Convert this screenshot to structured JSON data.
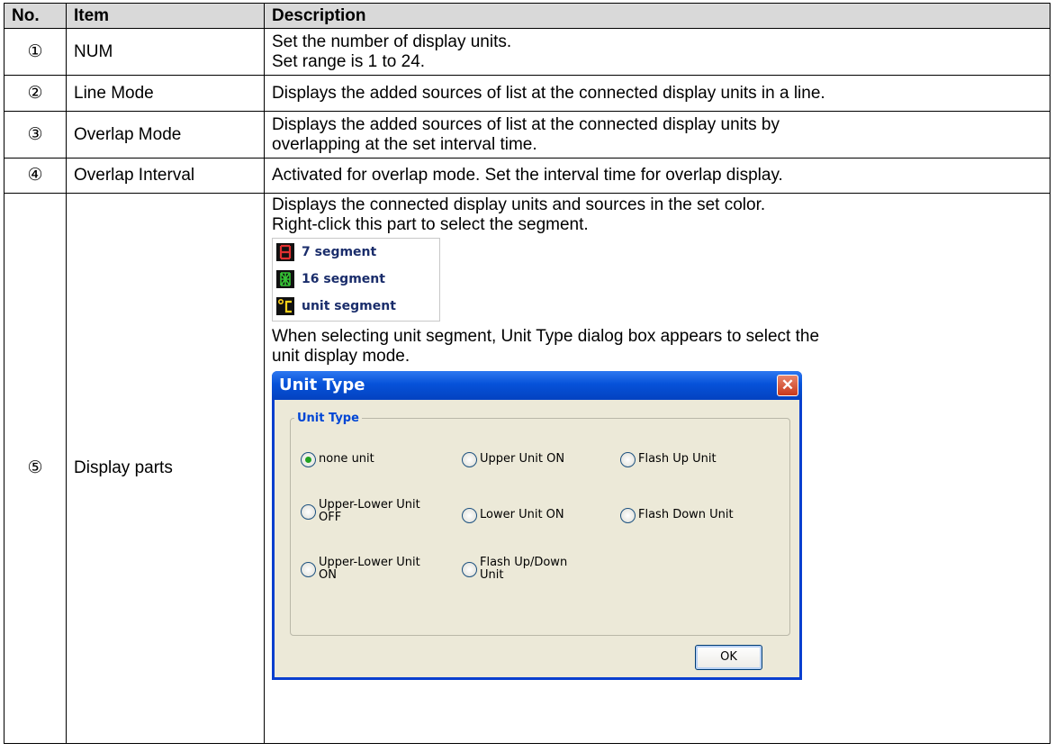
{
  "table": {
    "headers": {
      "no": "No.",
      "item": "Item",
      "description": "Description"
    },
    "rows": [
      {
        "no": "①",
        "item": "NUM",
        "desc_lines": [
          "Set the number of display units.",
          "Set range is 1 to 24."
        ]
      },
      {
        "no": "②",
        "item": "Line Mode",
        "desc_lines": [
          "Displays the added sources of list at the connected display units in a line."
        ]
      },
      {
        "no": "③",
        "item": "Overlap Mode",
        "desc_lines": [
          "Displays the added sources of list at the connected display units by",
          "overlapping at the set interval time."
        ]
      },
      {
        "no": "④",
        "item": "Overlap Interval",
        "desc_lines": [
          "Activated for overlap mode. Set the interval time for overlap display."
        ]
      },
      {
        "no": "⑤",
        "item": "Display parts",
        "desc_lines": [
          "Displays the connected display units and sources in the set color.",
          "Right-click this part to select the segment."
        ],
        "desc_after": [
          "When selecting unit segment, Unit Type dialog box appears to select the",
          "unit display mode."
        ]
      }
    ]
  },
  "segment_menu": [
    {
      "label": "7 segment",
      "icon": "seven-segment-icon",
      "color": "#e03030"
    },
    {
      "label": "16 segment",
      "icon": "sixteen-segment-icon",
      "color": "#35c435"
    },
    {
      "label": "unit segment",
      "icon": "unit-segment-icon",
      "color": "#ffd21a"
    }
  ],
  "dialog": {
    "title": "Unit Type",
    "group_label": "Unit Type",
    "options": [
      [
        "none unit"
      ],
      [
        "Upper Unit ON"
      ],
      [
        "Flash Up Unit"
      ],
      [
        "Upper-Lower Unit",
        "OFF"
      ],
      [
        "Lower Unit ON"
      ],
      [
        "Flash Down Unit"
      ],
      [
        "Upper-Lower Unit",
        "ON"
      ],
      [
        "Flash Up/Down",
        "Unit"
      ]
    ],
    "selected_index": 0,
    "ok_label": "OK"
  }
}
